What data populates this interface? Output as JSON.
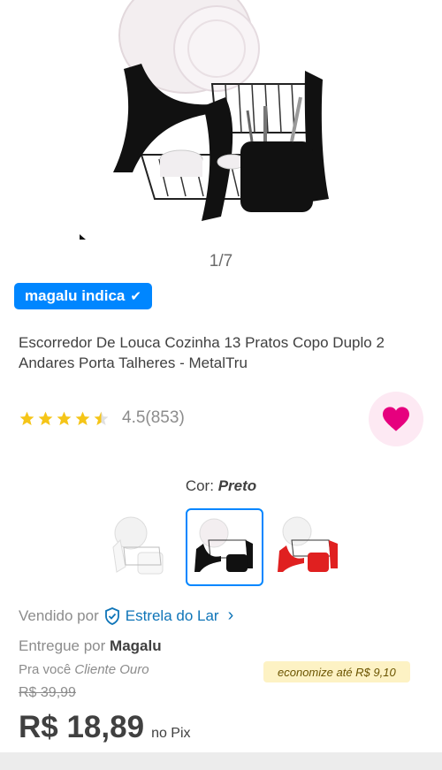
{
  "gallery": {
    "counter": "1/7"
  },
  "badge": {
    "label": "magalu indica",
    "check_icon": "check-icon"
  },
  "product": {
    "title": "Escorredor De Louca Cozinha 13 Pratos Copo Duplo 2 Andares Porta Talheres - MetalTru"
  },
  "rating": {
    "stars": 4.5,
    "text": "4.5(853)",
    "star_color": "#f5c518"
  },
  "favorite": {
    "icon": "heart-icon",
    "color": "#e6007e"
  },
  "color_selector": {
    "label": "Cor:",
    "selected": "Preto",
    "options": [
      {
        "name": "branco-thumb",
        "color": "#f2f2f2"
      },
      {
        "name": "preto-thumb",
        "color": "#111111"
      },
      {
        "name": "vermelho-thumb",
        "color": "#e02020"
      }
    ]
  },
  "seller": {
    "prefix": "Vendido por",
    "store": "Estrela do Lar",
    "icon": "verified-shield-icon"
  },
  "delivery": {
    "prefix": "Entregue por",
    "carrier": "Magalu"
  },
  "club": {
    "prefix": "Pra você",
    "tier": "Cliente Ouro"
  },
  "savings": {
    "label": "economize até R$ 9,10"
  },
  "pricing": {
    "old_price": "R$ 39,99",
    "price": "R$ 18,89",
    "suffix": "no Pix"
  },
  "colors": {
    "accent": "#0086ff",
    "link": "#0f75b8"
  }
}
